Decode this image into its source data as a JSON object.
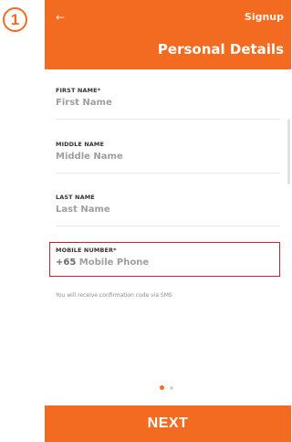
{
  "step": {
    "number": "1"
  },
  "header": {
    "back_icon": "arrow-left-icon",
    "back_glyph": "←",
    "signup_label": "Signup",
    "title": "Personal Details",
    "color": "#f26b21"
  },
  "form": {
    "first_name": {
      "label": "FIRST NAME*",
      "placeholder": "First Name"
    },
    "middle_name": {
      "label": "MIDDLE NAME",
      "placeholder": "Middle Name"
    },
    "last_name": {
      "label": "LAST NAME",
      "placeholder": "Last Name"
    },
    "mobile": {
      "label": "MOBILE NUMBER*",
      "prefix": "+65",
      "placeholder": "Mobile Phone"
    },
    "sms_hint": "You will receive confirmation code via SMS"
  },
  "pager": {
    "pages": 2,
    "active": 1
  },
  "footer": {
    "next_label": "NEXT"
  },
  "highlight_color": "#d2202f"
}
